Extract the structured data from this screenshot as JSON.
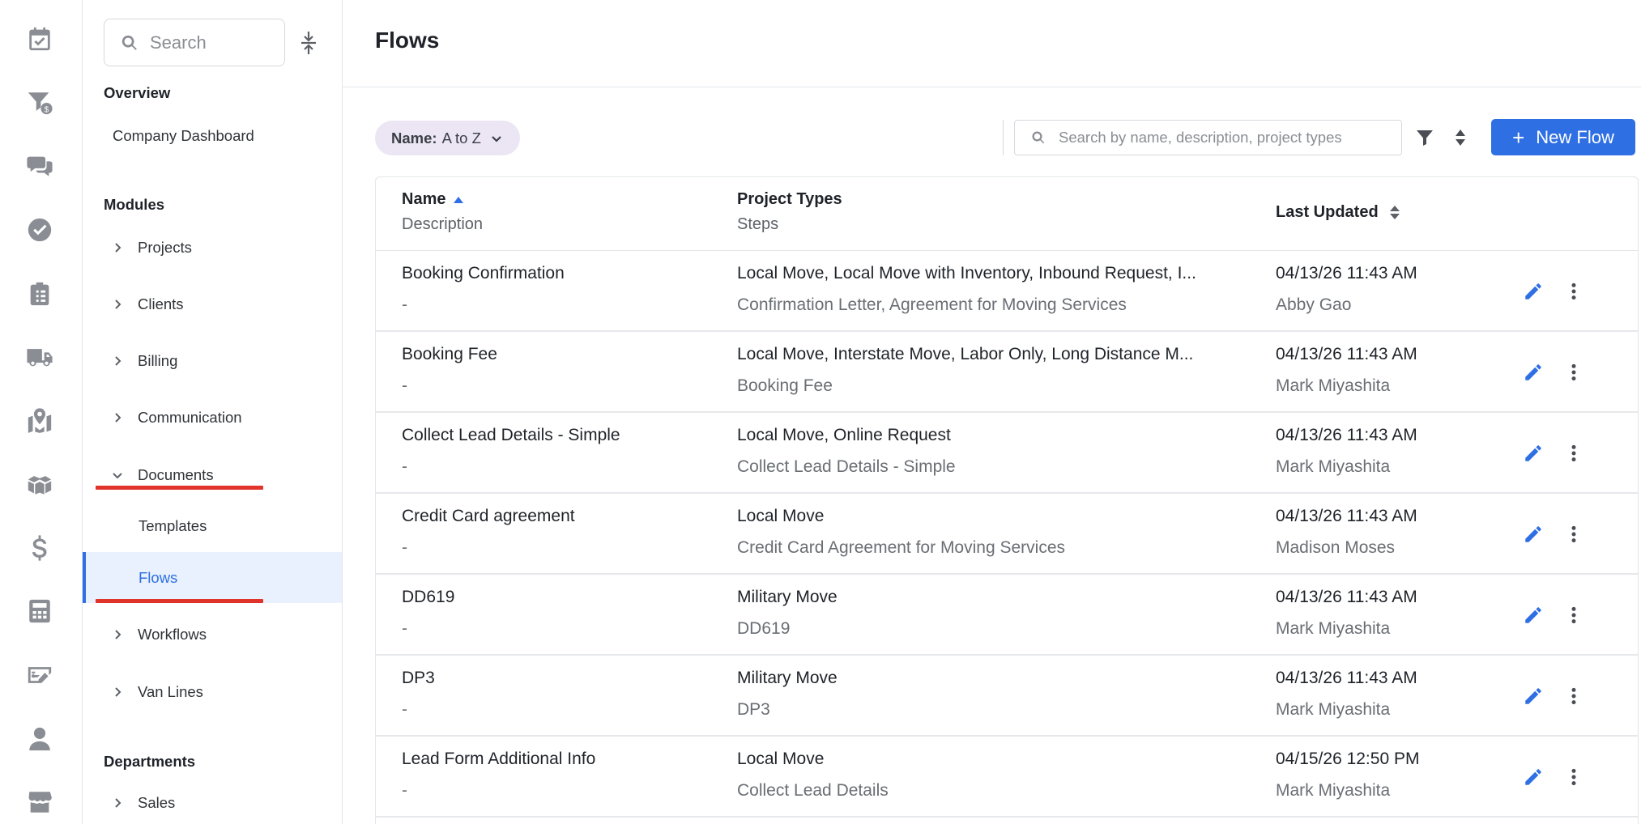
{
  "rail": {
    "icons": [
      "calendar-check-icon",
      "funnel-dollar-icon",
      "chat-bubbles-icon",
      "check-circle-icon",
      "clipboard-list-icon",
      "truck-icon",
      "map-pin-icon",
      "boxes-icon",
      "dollar-sign-icon",
      "calculator-icon",
      "money-check-edit-icon",
      "user-icon",
      "store-icon"
    ]
  },
  "nav": {
    "search_placeholder": "Search",
    "overview_heading": "Overview",
    "company_dashboard": "Company Dashboard",
    "modules_heading": "Modules",
    "items": [
      {
        "label": "Projects"
      },
      {
        "label": "Clients"
      },
      {
        "label": "Billing"
      },
      {
        "label": "Communication"
      },
      {
        "label": "Documents"
      },
      {
        "label": "Workflows"
      },
      {
        "label": "Van Lines"
      }
    ],
    "sub_items": [
      {
        "label": "Templates"
      },
      {
        "label": "Flows"
      }
    ],
    "departments_heading": "Departments",
    "dept_items": [
      {
        "label": "Sales"
      }
    ]
  },
  "main": {
    "title": "Flows",
    "sort_chip": {
      "key": "Name:",
      "value": "A to Z"
    },
    "search_placeholder": "Search by name, description, project types",
    "new_button_label": "New Flow",
    "new_button_plus": "+",
    "columns": {
      "name": "Name",
      "description": "Description",
      "project_types": "Project Types",
      "steps": "Steps",
      "last_updated": "Last Updated"
    },
    "rows": [
      {
        "name": "Booking Confirmation",
        "description": "-",
        "project_types": "Local Move, Local Move with Inventory, Inbound Request, I...",
        "steps": "Confirmation Letter, Agreement for Moving Services",
        "date": "04/13/26 11:43 AM",
        "user": "Abby Gao"
      },
      {
        "name": "Booking Fee",
        "description": "-",
        "project_types": "Local Move, Interstate Move, Labor Only, Long Distance M...",
        "steps": "Booking Fee",
        "date": "04/13/26 11:43 AM",
        "user": "Mark Miyashita"
      },
      {
        "name": "Collect Lead Details - Simple",
        "description": "-",
        "project_types": "Local Move, Online Request",
        "steps": "Collect Lead Details - Simple",
        "date": "04/13/26 11:43 AM",
        "user": "Mark Miyashita"
      },
      {
        "name": "Credit Card agreement",
        "description": "-",
        "project_types": "Local Move",
        "steps": "Credit Card Agreement for Moving Services",
        "date": "04/13/26 11:43 AM",
        "user": "Madison Moses"
      },
      {
        "name": "DD619",
        "description": "-",
        "project_types": "Military Move",
        "steps": "DD619",
        "date": "04/13/26 11:43 AM",
        "user": "Mark Miyashita"
      },
      {
        "name": "DP3",
        "description": "-",
        "project_types": "Military Move",
        "steps": "DP3",
        "date": "04/13/26 11:43 AM",
        "user": "Mark Miyashita"
      },
      {
        "name": "Lead Form Additional Info",
        "description": "-",
        "project_types": "Local Move",
        "steps": "Collect Lead Details",
        "date": "04/15/26 12:50 PM",
        "user": "Mark Miyashita"
      }
    ]
  },
  "colors": {
    "accent": "#2f6fe4",
    "highlight_underline": "#e0342b",
    "active_nav_bg": "#e8f1fd",
    "chip_bg": "#ece6f4"
  }
}
